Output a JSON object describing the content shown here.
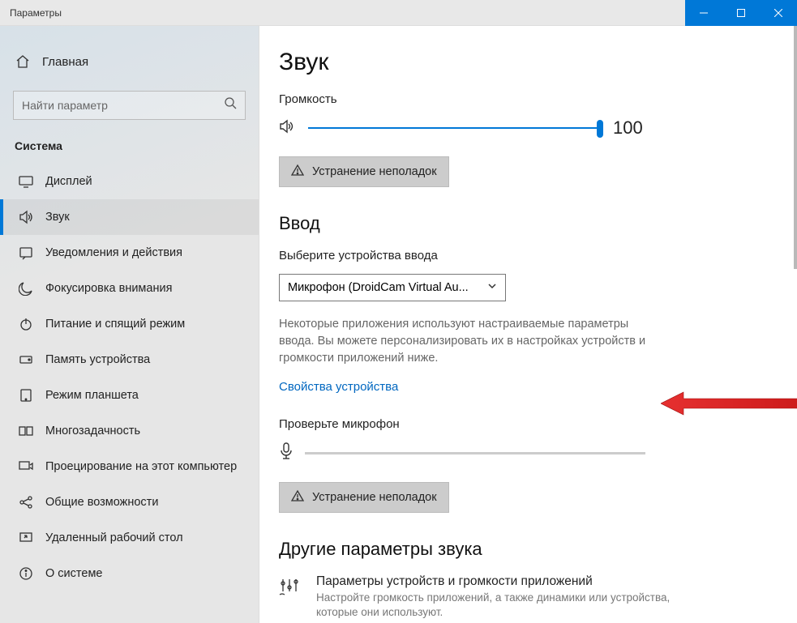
{
  "window": {
    "title": "Параметры"
  },
  "sidebar": {
    "home": "Главная",
    "search_placeholder": "Найти параметр",
    "section": "Система",
    "items": [
      {
        "label": "Дисплей"
      },
      {
        "label": "Звук"
      },
      {
        "label": "Уведомления и действия"
      },
      {
        "label": "Фокусировка внимания"
      },
      {
        "label": "Питание и спящий режим"
      },
      {
        "label": "Память устройства"
      },
      {
        "label": "Режим планшета"
      },
      {
        "label": "Многозадачность"
      },
      {
        "label": "Проецирование на этот компьютер"
      },
      {
        "label": "Общие возможности"
      },
      {
        "label": "Удаленный рабочий стол"
      },
      {
        "label": "О системе"
      }
    ]
  },
  "main": {
    "title": "Звук",
    "volume_label": "Громкость",
    "volume_value": "100",
    "troubleshoot": "Устранение неполадок",
    "input_heading": "Ввод",
    "input_select_label": "Выберите устройства ввода",
    "input_device": "Микрофон (DroidCam Virtual Au...",
    "input_desc": "Некоторые приложения используют настраиваемые параметры ввода. Вы можете персонализировать их в настройках устройств и громкости приложений ниже.",
    "device_props_link": "Свойства устройства",
    "test_mic_label": "Проверьте микрофон",
    "troubleshoot2": "Устранение неполадок",
    "other_heading": "Другие параметры звука",
    "other_item_title": "Параметры устройств и громкости приложений",
    "other_item_desc": "Настройте громкость приложений, а также динамики или устройства, которые они используют."
  }
}
